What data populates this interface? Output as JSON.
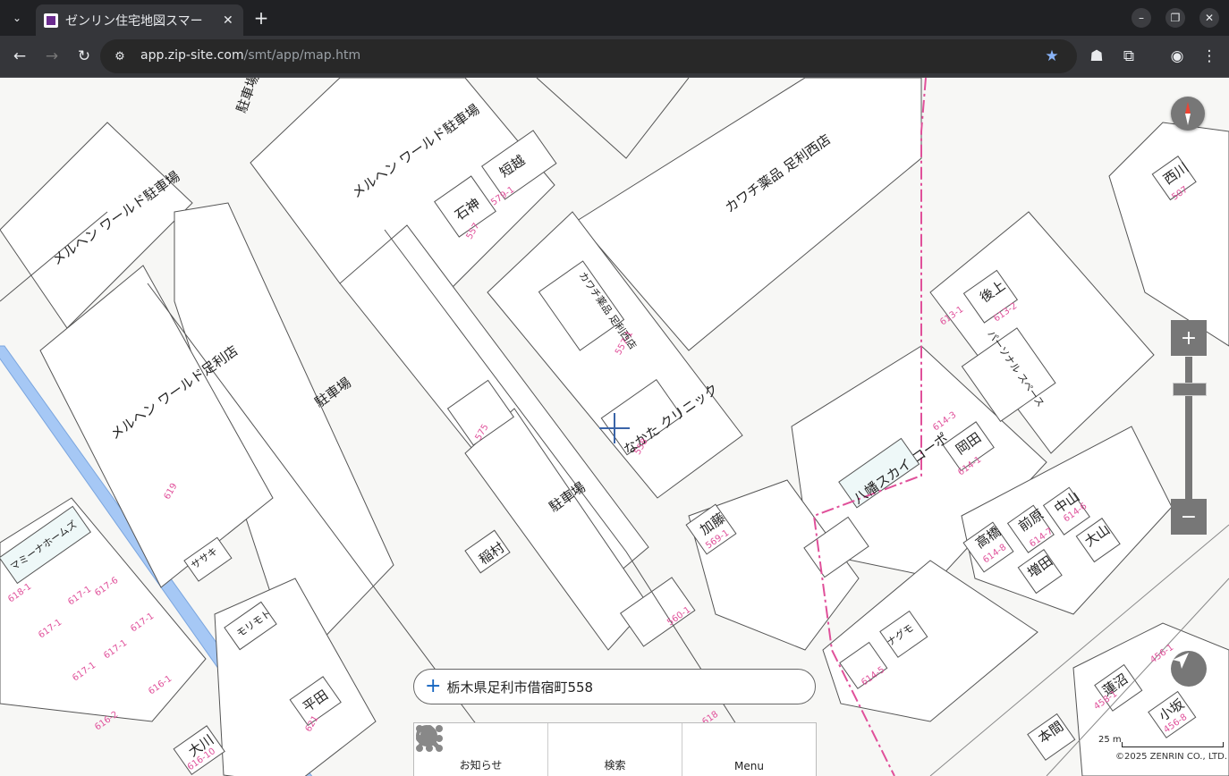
{
  "browser": {
    "tab_title": "ゼンリン住宅地図スマー",
    "url_host": "app.zip-site.com",
    "url_path": "/smt/app/map.htm"
  },
  "map": {
    "labels": [
      "メルヘン ワールド駐車場",
      "メルヘン ワールド駐車場",
      "駐車場",
      "短越",
      "石神",
      "カワチ薬品 足利西店",
      "メルヘン ワールド足利店",
      "駐車場",
      "カワチ薬品 足利西店",
      "なかた クリニック",
      "駐車場",
      "稲村",
      "ササキ",
      "モリモト",
      "マミーナホームズ",
      "平田",
      "大川",
      "加藤",
      "ナグモ",
      "八幡スカイ コーポ",
      "岡田",
      "後上",
      "西川",
      "高橋",
      "前原",
      "中山",
      "大山",
      "増田",
      "蓮沼",
      "小坂",
      "本間",
      "パーソナル スペース"
    ],
    "lot_numbers": [
      "579-1",
      "557",
      "557-1",
      "575",
      "558",
      "619",
      "618-1",
      "617-1",
      "617-6",
      "617-1",
      "617-1",
      "617-1",
      "617-1",
      "616-1",
      "616-2",
      "621",
      "616-10",
      "569-1",
      "614-5",
      "614-1",
      "613-2",
      "613-1",
      "614-8",
      "614-7",
      "614-6",
      "456-1",
      "458-1",
      "456-8",
      "507",
      "560-1",
      "618",
      "614-3"
    ]
  },
  "search": {
    "address": "栃木県足利市借宿町558"
  },
  "bottom_nav": [
    {
      "label": "お知らせ",
      "icon": "bell-icon"
    },
    {
      "label": "検索",
      "icon": "search-icon"
    },
    {
      "label": "Menu",
      "icon": "grid-menu-icon"
    }
  ],
  "scale": {
    "label": "25 m"
  },
  "copyright": "©2025 ZENRIN CO., LTD.",
  "colors": {
    "boundary_pink": "#e0509a",
    "river_blue": "#a6c8f5",
    "control_gray": "#777777"
  }
}
